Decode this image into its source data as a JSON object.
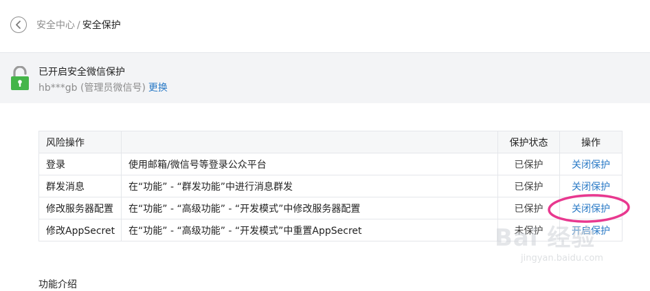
{
  "header": {
    "back_icon": "chevron-left-icon",
    "breadcrumb_parent": "安全中心",
    "breadcrumb_separator": "/",
    "breadcrumb_current": "安全保护"
  },
  "banner": {
    "lock_icon": "lock-open-icon",
    "title": "已开启安全微信保护",
    "account": "hb***gb (管理员微信号)",
    "change_link": "更换",
    "accent_color": "#4caf50"
  },
  "table": {
    "headers": [
      "风险操作",
      "",
      "保护状态",
      "操作"
    ],
    "rows": [
      {
        "operation": "登录",
        "description": "使用邮箱/微信号等登录公众平台",
        "status": "已保护",
        "action": "关闭保护"
      },
      {
        "operation": "群发消息",
        "description": "在“功能” - “群发功能”中进行消息群发",
        "status": "已保护",
        "action": "关闭保护"
      },
      {
        "operation": "修改服务器配置",
        "description": "在“功能” - “高级功能” - “开发模式”中修改服务器配置",
        "status": "已保护",
        "action": "关闭保护"
      },
      {
        "operation": "修改AppSecret",
        "description": "在“功能” - “高级功能” - “开发模式”中重置AppSecret",
        "status": "未保护",
        "action": "开启保护"
      }
    ],
    "link_color": "#2a7ac6"
  },
  "annotation": {
    "color": "#e8388f"
  },
  "footer": {
    "title": "功能介绍"
  },
  "watermark": {
    "main": "Bai 经验",
    "sub": "jingyan.baidu.com"
  }
}
